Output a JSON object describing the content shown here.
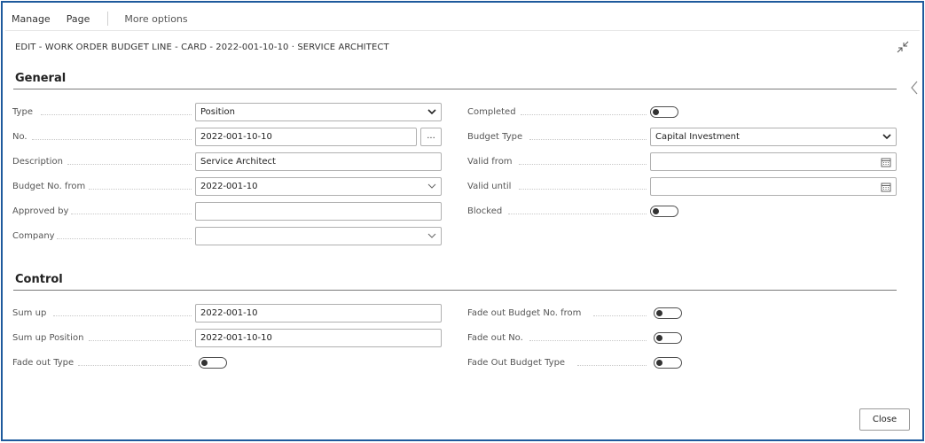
{
  "menu": {
    "manage": "Manage",
    "page": "Page",
    "more": "More options"
  },
  "title": "EDIT - WORK ORDER BUDGET LINE - CARD - 2022-001-10-10 · SERVICE ARCHITECT",
  "general": {
    "heading": "General",
    "type": {
      "label": "Type",
      "value": "Position"
    },
    "no": {
      "label": "No.",
      "value": "2022-001-10-10",
      "assist": "..."
    },
    "description": {
      "label": "Description",
      "value": "Service Architect"
    },
    "budget_no_from": {
      "label": "Budget No. from",
      "value": "2022-001-10"
    },
    "approved_by": {
      "label": "Approved by",
      "value": ""
    },
    "company": {
      "label": "Company",
      "value": ""
    },
    "completed": {
      "label": "Completed",
      "on": false
    },
    "budget_type": {
      "label": "Budget Type",
      "value": "Capital Investment"
    },
    "valid_from": {
      "label": "Valid from",
      "value": ""
    },
    "valid_until": {
      "label": "Valid until",
      "value": ""
    },
    "blocked": {
      "label": "Blocked",
      "on": false
    }
  },
  "control": {
    "heading": "Control",
    "sum_up": {
      "label": "Sum up",
      "value": "2022-001-10"
    },
    "sum_up_position": {
      "label": "Sum up Position",
      "value": "2022-001-10-10"
    },
    "fade_out_type": {
      "label": "Fade out Type",
      "on": false
    },
    "fade_out_budget_no_from": {
      "label": "Fade out Budget No. from",
      "on": false
    },
    "fade_out_no": {
      "label": "Fade out No.",
      "on": false
    },
    "fade_out_budget_type": {
      "label": "Fade Out Budget Type",
      "on": false
    }
  },
  "buttons": {
    "close": "Close"
  }
}
